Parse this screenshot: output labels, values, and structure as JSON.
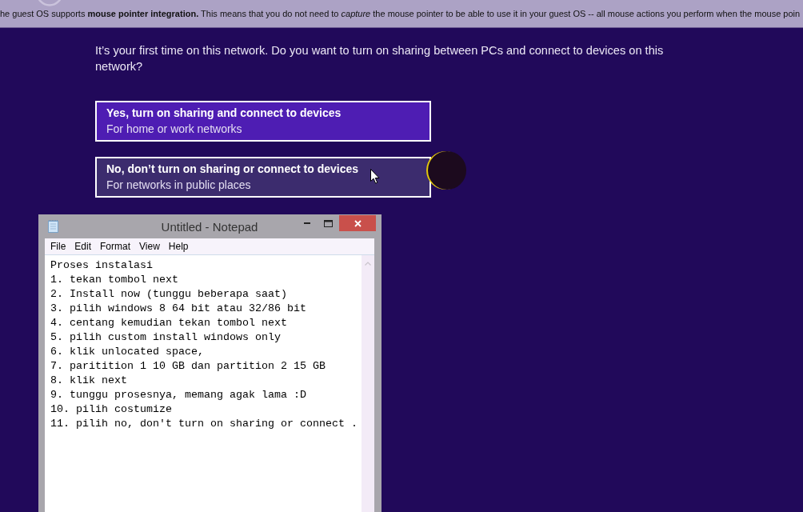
{
  "notification": {
    "text": "he guest OS supports **mouse pointer integration.** This means that you do not need to *capture* the mouse pointer to be able to use it in your guest OS -- all mouse actions you perform when the mouse poin"
  },
  "prompt": "It’s your first time on this network. Do you want to turn on sharing between PCs and connect to devices on this network?",
  "options": [
    {
      "title": "Yes, turn on sharing and connect to devices",
      "subtitle": "For home or work networks",
      "hovered": false
    },
    {
      "title": "No, don’t turn on sharing or connect to devices",
      "subtitle": "For networks in public places",
      "hovered": true
    }
  ],
  "notepad": {
    "title": "Untitled - Notepad",
    "menu": [
      "File",
      "Edit",
      "Format",
      "View",
      "Help"
    ],
    "lines": [
      "Proses instalasi",
      "1. tekan tombol next",
      "2. Install now (tunggu beberapa saat)",
      "3. pilih windows 8 64 bit atau 32/86 bit",
      "4. centang kemudian tekan tombol next",
      "5. pilih custom install windows only",
      "6. klik unlocated space,",
      "7. paritition 1 10 GB dan partition 2 15 GB",
      "8. klik next",
      "9. tunggu prosesnya, memang agak lama :D",
      "10. pilih costumize",
      "11. pilih no, don't turn on sharing or connect ."
    ]
  }
}
